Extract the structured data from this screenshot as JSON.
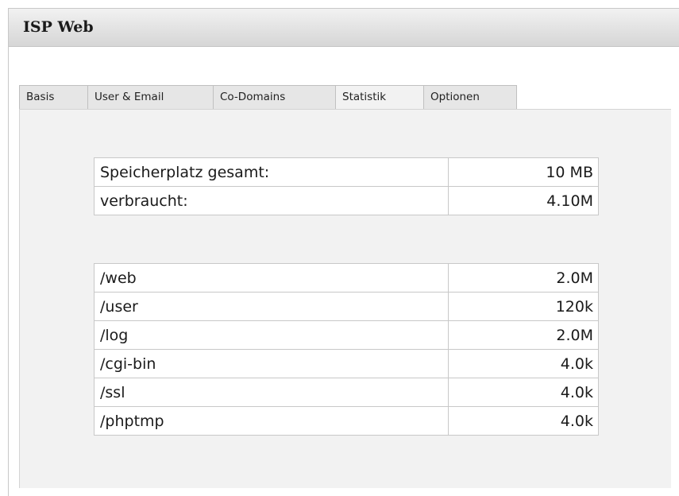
{
  "window": {
    "title": "ISP Web"
  },
  "tabs": [
    {
      "label": "Basis",
      "active": false
    },
    {
      "label": "User & Email",
      "active": false
    },
    {
      "label": "Co-Domains",
      "active": false
    },
    {
      "label": "Statistik",
      "active": true
    },
    {
      "label": "Optionen",
      "active": false
    }
  ],
  "storage": {
    "total_label": "Speicherplatz gesamt:",
    "total_value": "10 MB",
    "used_label": "verbraucht:",
    "used_value": "4.10M"
  },
  "directories": [
    {
      "path": "/web",
      "size": "2.0M"
    },
    {
      "path": "/user",
      "size": "120k"
    },
    {
      "path": "/log",
      "size": "2.0M"
    },
    {
      "path": "/cgi-bin",
      "size": "4.0k"
    },
    {
      "path": "/ssl",
      "size": "4.0k"
    },
    {
      "path": "/phptmp",
      "size": "4.0k"
    }
  ],
  "colors": {
    "panel_background": "#f2f2f2",
    "tab_background": "#e6e6e6",
    "border": "#c8c8c8"
  }
}
